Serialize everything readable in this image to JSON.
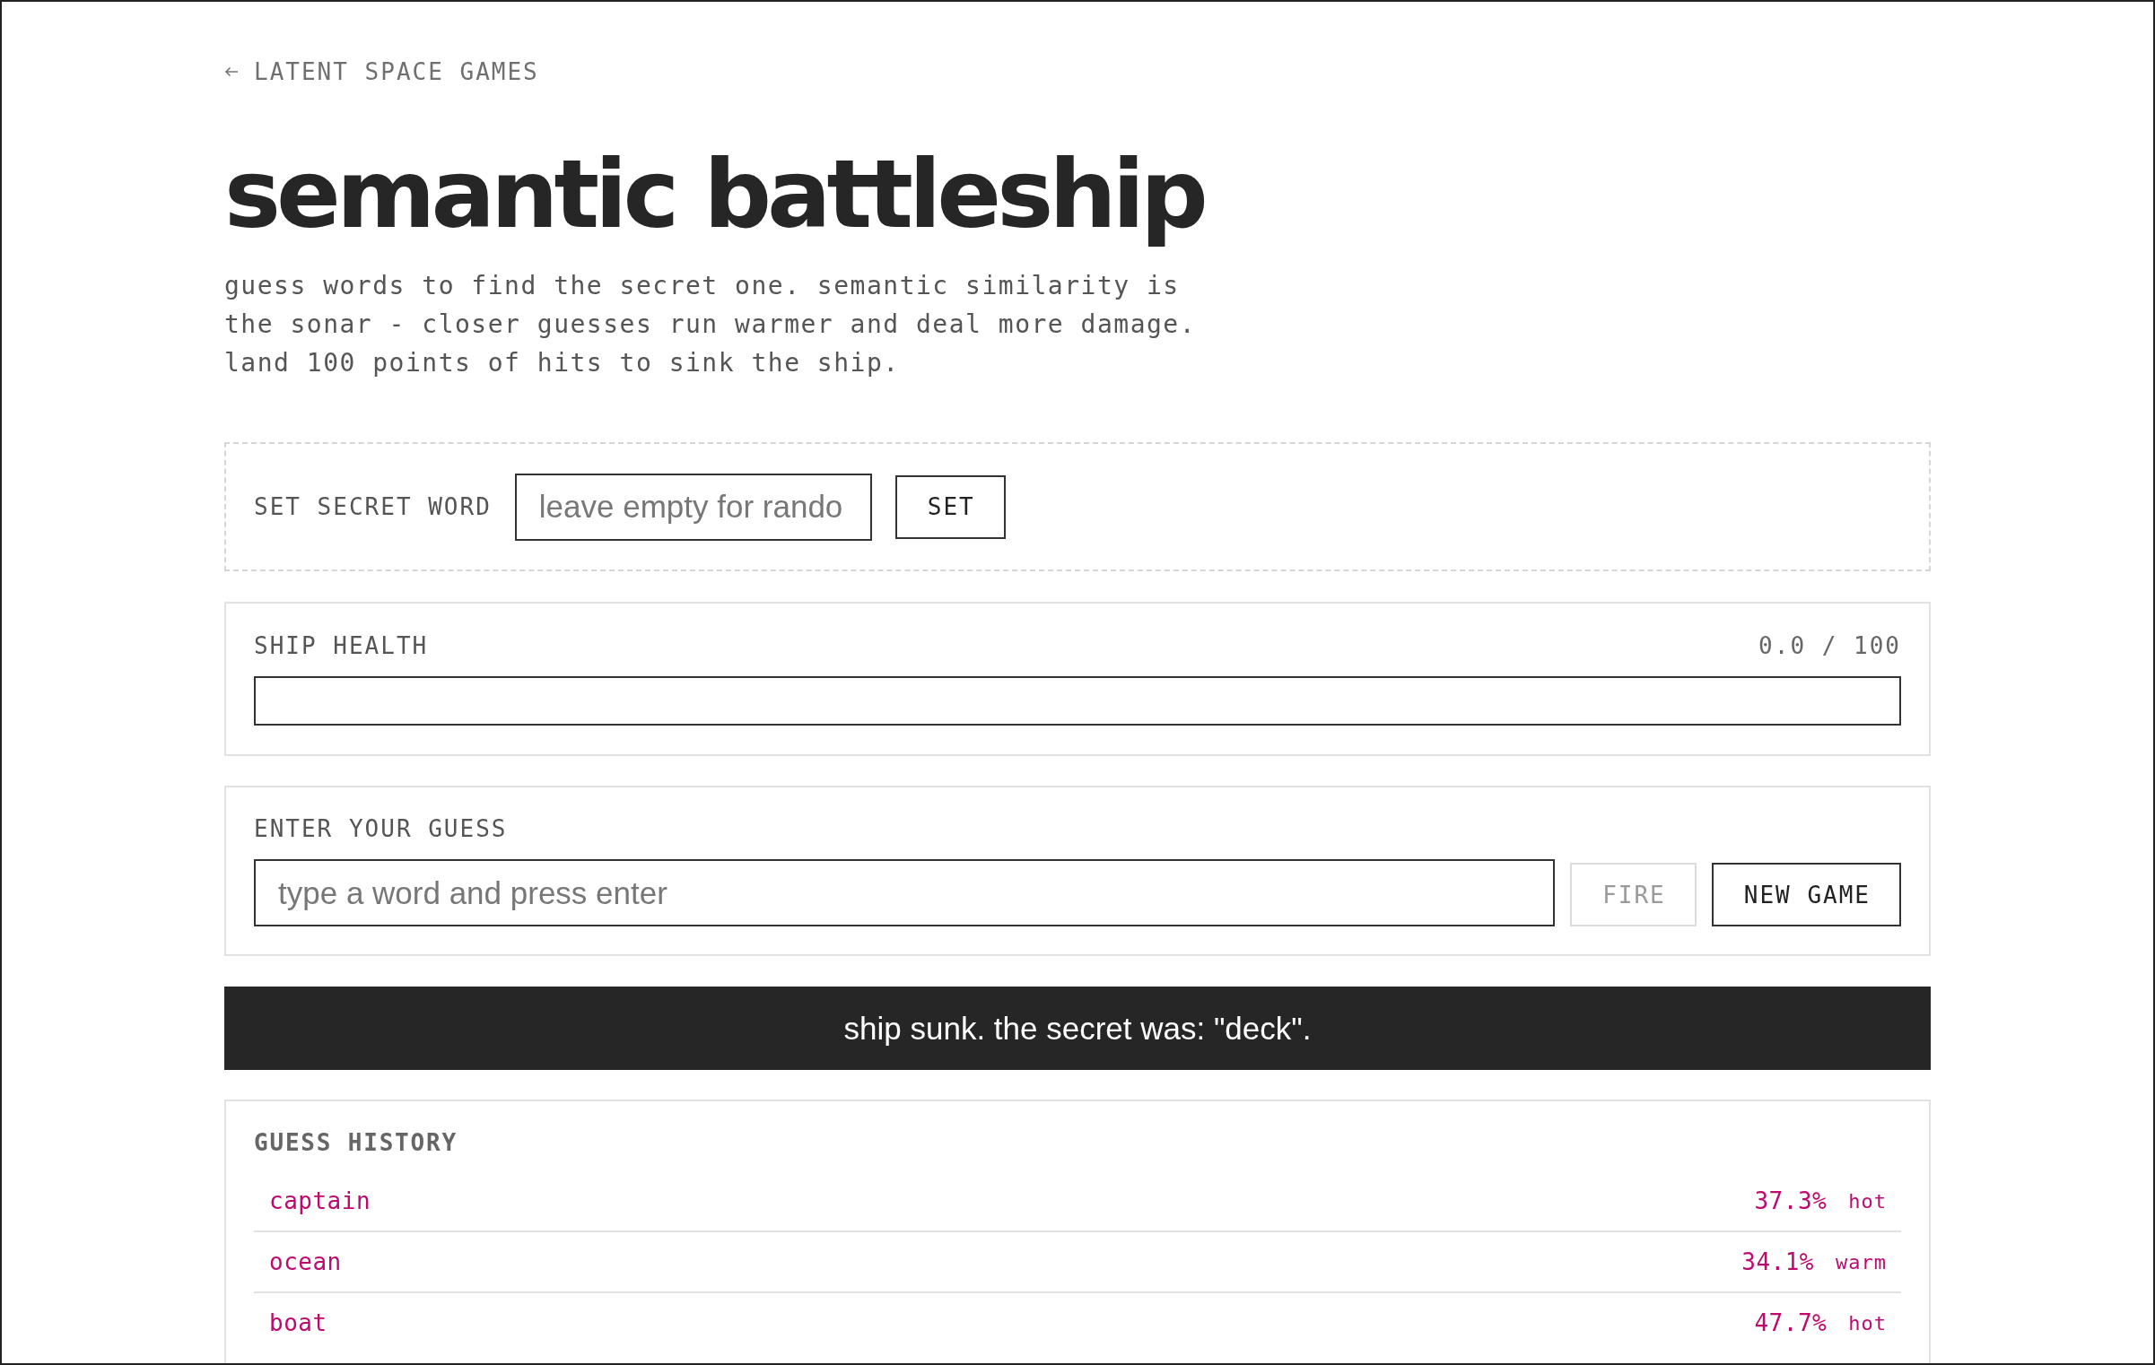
{
  "back_link": {
    "label": "LATENT SPACE GAMES"
  },
  "title": "semantic battleship",
  "description": "guess words to find the secret one. semantic similarity is the sonar - closer guesses run warmer and deal more damage. land 100 points of hits to sink the ship.",
  "secret_word": {
    "label": "SET SECRET WORD",
    "placeholder": "leave empty for rando",
    "button": "SET"
  },
  "ship_health": {
    "label": "SHIP HEALTH",
    "reading": "0.0 / 100",
    "level": 0
  },
  "guess": {
    "label": "ENTER YOUR GUESS",
    "placeholder": "type a word and press enter",
    "buttons": [
      {
        "label": "FIRE",
        "disabled": true
      },
      {
        "label": "NEW GAME",
        "disabled": false
      }
    ]
  },
  "message": "ship sunk. the secret was: \"deck\".",
  "guess_history": {
    "title": "GUESS HISTORY",
    "rows": [
      {
        "word": "captain",
        "similarity": "37.3%",
        "heat": "hot"
      },
      {
        "word": "ocean",
        "similarity": "34.1%",
        "heat": "warm"
      },
      {
        "word": "boat",
        "similarity": "47.7%",
        "heat": "hot"
      }
    ]
  }
}
